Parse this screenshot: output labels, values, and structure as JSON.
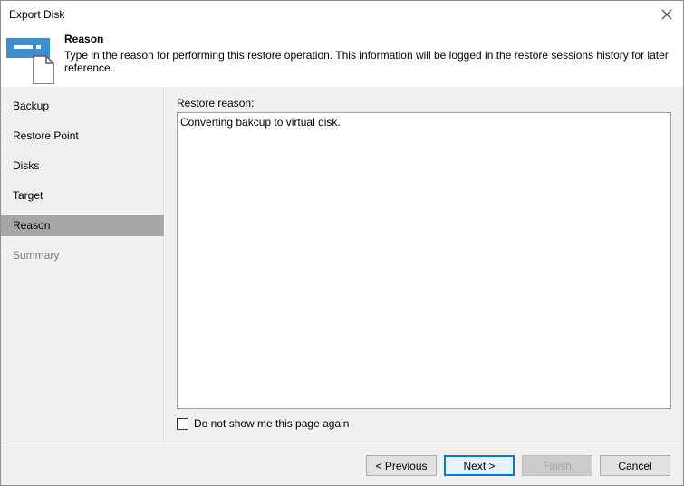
{
  "window": {
    "title": "Export Disk"
  },
  "header": {
    "title": "Reason",
    "description": "Type in the reason for performing this restore operation. This information will be logged in the restore sessions history for later reference."
  },
  "sidebar": {
    "items": [
      {
        "label": "Backup",
        "state": "normal"
      },
      {
        "label": "Restore Point",
        "state": "normal"
      },
      {
        "label": "Disks",
        "state": "normal"
      },
      {
        "label": "Target",
        "state": "normal"
      },
      {
        "label": "Reason",
        "state": "active"
      },
      {
        "label": "Summary",
        "state": "disabled"
      }
    ]
  },
  "content": {
    "reason_label": "Restore reason:",
    "reason_value": "Converting bakcup to virtual disk.",
    "checkbox_label": "Do not show me this page again",
    "checkbox_checked": false
  },
  "footer": {
    "previous": "< Previous",
    "next": "Next >",
    "finish": "Finish",
    "cancel": "Cancel"
  },
  "colors": {
    "accent": "#0078d7",
    "icon_blue": "#3c8fd0",
    "selected_nav": "#a6a6a6"
  }
}
